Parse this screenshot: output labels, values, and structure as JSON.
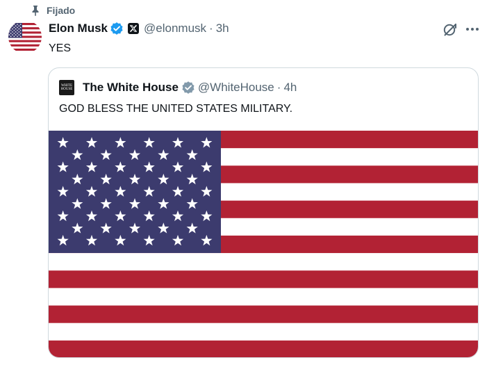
{
  "pinned": {
    "label": "Fijado",
    "icon": "pin-icon"
  },
  "tweet": {
    "author": {
      "display_name": "Elon Musk",
      "handle": "@elonmusk",
      "verified_icon": "verified-badge-icon",
      "affiliate_icon": "x-logo-icon",
      "avatar": "us-flag-avatar"
    },
    "separator": "·",
    "time": "3h",
    "text": "YES",
    "actions": {
      "grok_icon": "grok-icon",
      "more_icon": "more-options-icon"
    }
  },
  "quote": {
    "author": {
      "display_name": "The White House",
      "handle": "@WhiteHouse",
      "verified_icon": "gray-verified-badge-icon",
      "avatar_text": "WHITE HOUSE"
    },
    "separator": "·",
    "time": "4h",
    "text": "GOD BLESS THE UNITED STATES MILITARY.",
    "media": "us-flag-image"
  },
  "colors": {
    "flag_red": "#b22234",
    "flag_blue": "#3c3b6e",
    "verified_blue": "#1d9bf0",
    "verified_gray": "#829aab",
    "secondary_text": "#536471",
    "border": "#cfd9de"
  }
}
